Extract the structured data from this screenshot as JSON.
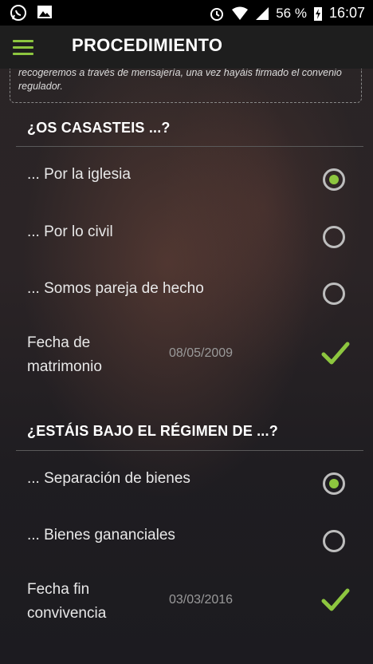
{
  "status_bar": {
    "battery_text": "56 %",
    "time": "16:07",
    "icons": [
      "whatsapp-icon",
      "gallery-icon",
      "alarm-icon",
      "wifi-icon",
      "signal-icon",
      "battery-charging-icon"
    ]
  },
  "app_bar": {
    "title": "PROCEDIMIENTO",
    "menu_icon": "hamburger-icon"
  },
  "notice": {
    "text": "recogeremos a través de mensajería, una vez hayáis firmado el convenio regulador."
  },
  "colors": {
    "accent": "#8dc63f",
    "text": "#e8e8e8",
    "muted": "#9a9a9a",
    "appbar": "#1e1e1e"
  },
  "section_marriage": {
    "title": "¿OS CASASTEIS ...?",
    "options": [
      {
        "label": "... Por la iglesia",
        "selected": true
      },
      {
        "label": "... Por lo civil",
        "selected": false
      },
      {
        "label": "... Somos pareja de hecho",
        "selected": false
      }
    ],
    "date": {
      "label_line1": "Fecha de",
      "label_line2": "matrimonio",
      "value": "08/05/2009"
    }
  },
  "section_regime": {
    "title": "¿ESTÁIS BAJO EL RÉGIMEN DE ...?",
    "options": [
      {
        "label": "... Separación de bienes",
        "selected": true
      },
      {
        "label": "... Bienes gananciales",
        "selected": false
      }
    ],
    "date": {
      "label_line1": "Fecha fin",
      "label_line2": "convivencia",
      "value": "03/03/2016"
    }
  }
}
